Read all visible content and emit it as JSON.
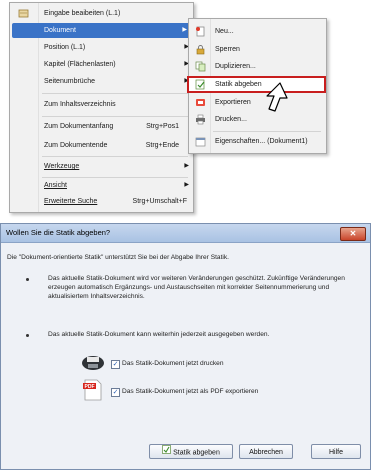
{
  "menu": {
    "items": [
      {
        "label": "Eingabe beaibeiten (L.1)",
        "shortcut": "",
        "arrow": false,
        "icon": "edit-icon"
      },
      {
        "label": "Dokument",
        "shortcut": "",
        "arrow": true,
        "highlighted": true
      },
      {
        "label": "Position (L.1)",
        "shortcut": "",
        "arrow": true
      },
      {
        "label": "Kapitel (Flächenlasten)",
        "shortcut": "",
        "arrow": true
      },
      {
        "label": "Seitenumbrüche",
        "shortcut": "",
        "arrow": true
      },
      {
        "label": "Zum Inhaltsverzeichnis",
        "shortcut": "",
        "arrow": false
      },
      {
        "label": "Zum Dokumentanfang",
        "shortcut": "Strg+Pos1",
        "arrow": false
      },
      {
        "label": "Zum Dokumentende",
        "shortcut": "Strg+Ende",
        "arrow": false
      },
      {
        "label": "Werkzeuge",
        "shortcut": "",
        "arrow": true,
        "underline": "W"
      },
      {
        "label": "Ansicht",
        "shortcut": "",
        "arrow": true,
        "underline": "A"
      },
      {
        "label": "Erweiterte Suche",
        "shortcut": "Strg+Umschalt+F",
        "arrow": false,
        "underline": "E"
      }
    ]
  },
  "submenu": {
    "items": [
      {
        "label": "Neu...",
        "icon": "new-doc-icon"
      },
      {
        "label": "Sperren",
        "icon": "lock-icon"
      },
      {
        "label": "Duplizieren...",
        "icon": "duplicate-icon"
      },
      {
        "label": "Statik abgeben",
        "icon": "handover-icon",
        "selected": true
      },
      {
        "label": "Exportieren",
        "icon": "export-icon"
      },
      {
        "label": "Drucken...",
        "icon": "print-icon"
      },
      {
        "label": "Eigenschaften... (Dokument1)",
        "icon": "properties-icon"
      }
    ]
  },
  "dialog": {
    "title": "Wollen Sie die Statik abgeben?",
    "close_label": "✕",
    "intro": "Die \"Dokument-orientierte Statik\" unterstützt Sie bei der Abgabe Ihrer Statik.",
    "bullet1": "Das aktuelle Statik-Dokument wird vor weiteren Veränderungen geschützt. Zukünftige Veränderungen erzeugen automatisch Ergänzungs- und Austauschseiten mit korrekter Seitennummerierung und aktualisiertem Inhaltsverzeichnis.",
    "bullet2": "Das aktuelle Statik-Dokument kann weiterhin jederzeit ausgegeben werden.",
    "option_print": {
      "label": "Das Statik-Dokument jetzt drucken",
      "checked": true
    },
    "option_pdf": {
      "label": "Das Statik-Dokument jetzt als PDF exportieren",
      "checked": true
    },
    "buttons": {
      "submit": "Statik abgeben",
      "cancel": "Abbrechen",
      "help": "Hilfe"
    }
  },
  "colors": {
    "highlight": "#3a73c7",
    "selection_border": "#c81e1e"
  }
}
